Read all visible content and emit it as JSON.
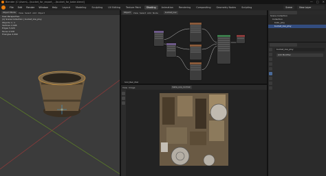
{
  "window": {
    "title": "Blender [C:\\Users\\...\\bucket_for_export_...\\bucket_for_bake.blend]",
    "controls": [
      "—",
      "□",
      "✕"
    ]
  },
  "menu": [
    "File",
    "Edit",
    "Render",
    "Window",
    "Help"
  ],
  "workspaces": [
    "Layout",
    "Modeling",
    "Sculpting",
    "UV Editing",
    "Texture Paint",
    "Shading",
    "Animation",
    "Rendering",
    "Compositing",
    "Geometry Nodes",
    "Scripting"
  ],
  "active_workspace": "Shading",
  "scene": "Scene",
  "view_layer": "View Layer",
  "viewport": {
    "header": [
      "Object Mode",
      "View",
      "Select",
      "Add",
      "Object"
    ],
    "overlay_title": "User Perspective",
    "collection": "(1) Scene Collection | bucket_low_ploy",
    "stats": [
      {
        "label": "Objects",
        "value": "1 / 1"
      },
      {
        "label": "Vertices",
        "value": "2,496"
      },
      {
        "label": "Edges",
        "value": "5,020"
      },
      {
        "label": "Faces",
        "value": "2,528"
      },
      {
        "label": "Triangles",
        "value": "4,990"
      }
    ]
  },
  "node_editor": {
    "header": [
      "Object",
      "View",
      "Select",
      "Add",
      "Node"
    ],
    "material": "bucket_low",
    "footer_label": "Slot_Bak_Mat"
  },
  "image_editor": {
    "header": [
      "View",
      "Image"
    ],
    "image_name": "bake_uvs_normal"
  },
  "outliner": {
    "items": [
      "Scene Collection",
      "Collection",
      "bake_ploy",
      "bucket_low_ploy"
    ],
    "selected_index": 3
  },
  "properties": {
    "object": "bucket_low_ploy",
    "section": "Add Modifier"
  }
}
